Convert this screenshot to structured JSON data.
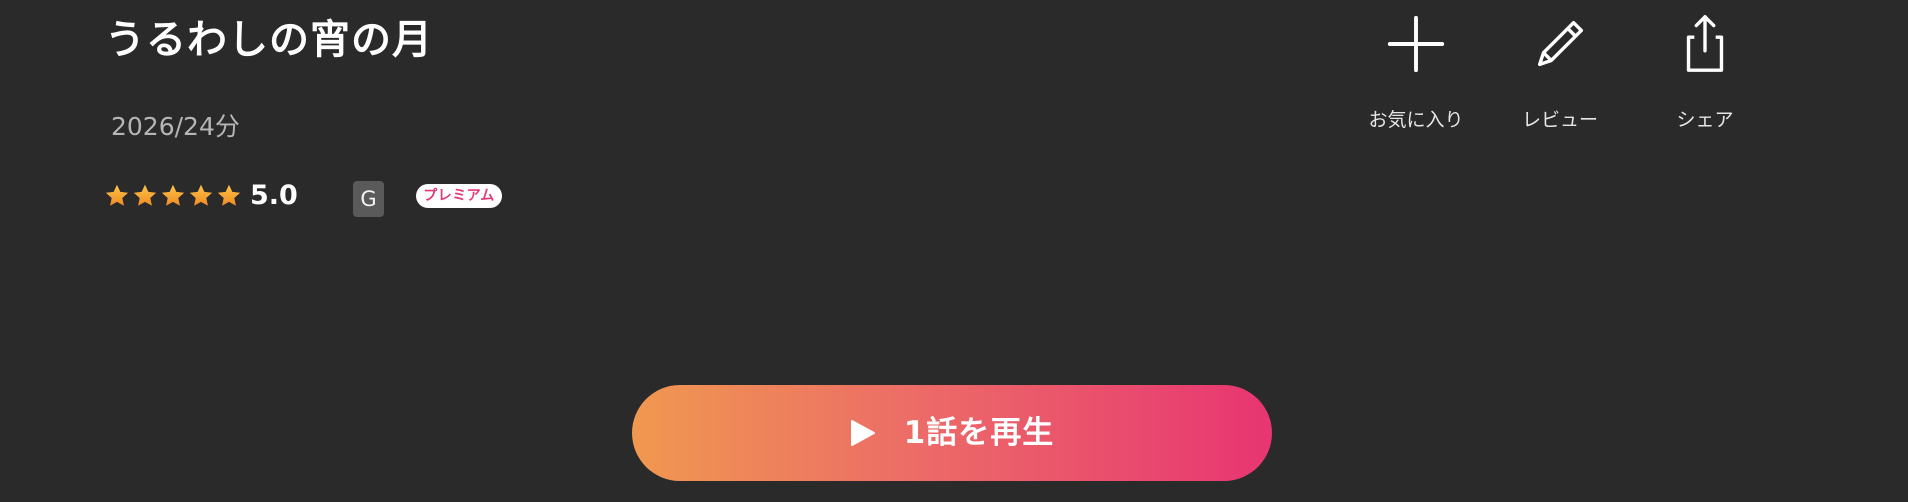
{
  "title": "うるわしの宵の月",
  "meta": "2026/24分",
  "rating": {
    "stars": 5,
    "score": "5.0",
    "star_color_top": "#ffc64a",
    "star_color_bottom": "#f08a22"
  },
  "badges": {
    "age_rating": "G",
    "premium": "プレミアム"
  },
  "actions": {
    "favorite": "お気に入り",
    "review": "レビュー",
    "share": "シェア"
  },
  "play_button": {
    "label": "1話を再生",
    "gradient_start": "#f09850",
    "gradient_end": "#e73572"
  },
  "colors": {
    "background": "#2a2a2a",
    "meta_text": "#b5b5b5",
    "accent_pink": "#e2397b"
  }
}
